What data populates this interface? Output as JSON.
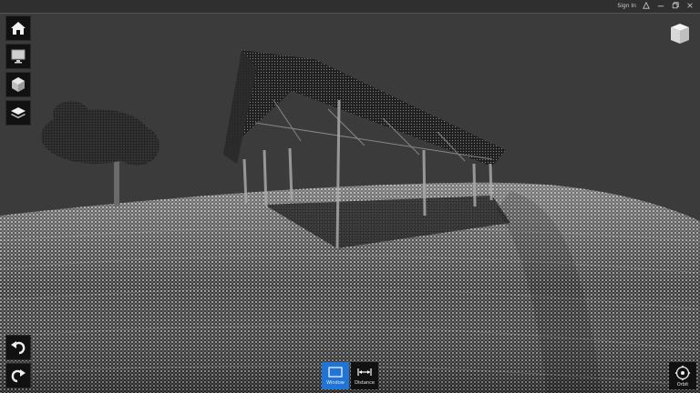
{
  "titlebar": {
    "sign_in_label": "Sign In"
  },
  "left_toolbar": {
    "items": [
      {
        "icon": "home-icon"
      },
      {
        "icon": "monitor-icon"
      },
      {
        "icon": "cube-icon"
      },
      {
        "icon": "layers-icon"
      }
    ]
  },
  "history": {
    "undo_icon": "undo-icon",
    "redo_icon": "redo-icon"
  },
  "bottom_toolbar": {
    "window_label": "Window",
    "distance_label": "Distance"
  },
  "orbit": {
    "label": "Orbit"
  },
  "colors": {
    "accent": "#1f74d6",
    "background": "#3b3b3b",
    "ground": "#d8d8d8"
  }
}
